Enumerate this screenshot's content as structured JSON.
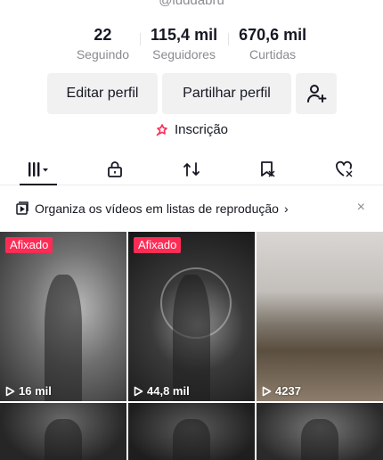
{
  "profile": {
    "username": "@luddabru",
    "stats": [
      {
        "value": "22",
        "label": "Seguindo"
      },
      {
        "value": "115,4 mil",
        "label": "Seguidores"
      },
      {
        "value": "670,6 mil",
        "label": "Curtidas"
      }
    ]
  },
  "actions": {
    "edit_label": "Editar perfil",
    "share_label": "Partilhar perfil",
    "add_friend_icon": "add-user-icon"
  },
  "inscription": {
    "label": "Inscrição",
    "icon": "subscription-icon",
    "icon_color": "#fe2c55"
  },
  "tabs": [
    {
      "name": "videos",
      "icon": "grid-icon",
      "active": true
    },
    {
      "name": "private",
      "icon": "lock-icon",
      "active": false
    },
    {
      "name": "reposts",
      "icon": "repost-icon",
      "active": false
    },
    {
      "name": "favorites",
      "icon": "bookmark-icon",
      "active": false
    },
    {
      "name": "liked",
      "icon": "heart-hidden-icon",
      "active": false
    }
  ],
  "playlist_banner": {
    "text": "Organiza os vídeos em listas de reprodução",
    "chevron": "›",
    "close": "×"
  },
  "videos": [
    {
      "pinned_label": "Afixado",
      "views": "16 mil"
    },
    {
      "pinned_label": "Afixado",
      "views": "44,8 mil"
    },
    {
      "pinned_label": "",
      "views": "4237"
    },
    {
      "pinned_label": "",
      "views": ""
    },
    {
      "pinned_label": "",
      "views": ""
    },
    {
      "pinned_label": "",
      "views": ""
    }
  ],
  "colors": {
    "accent": "#fe2c55",
    "button_bg": "#f1f1f2",
    "secondary_text": "#8a8b91"
  }
}
